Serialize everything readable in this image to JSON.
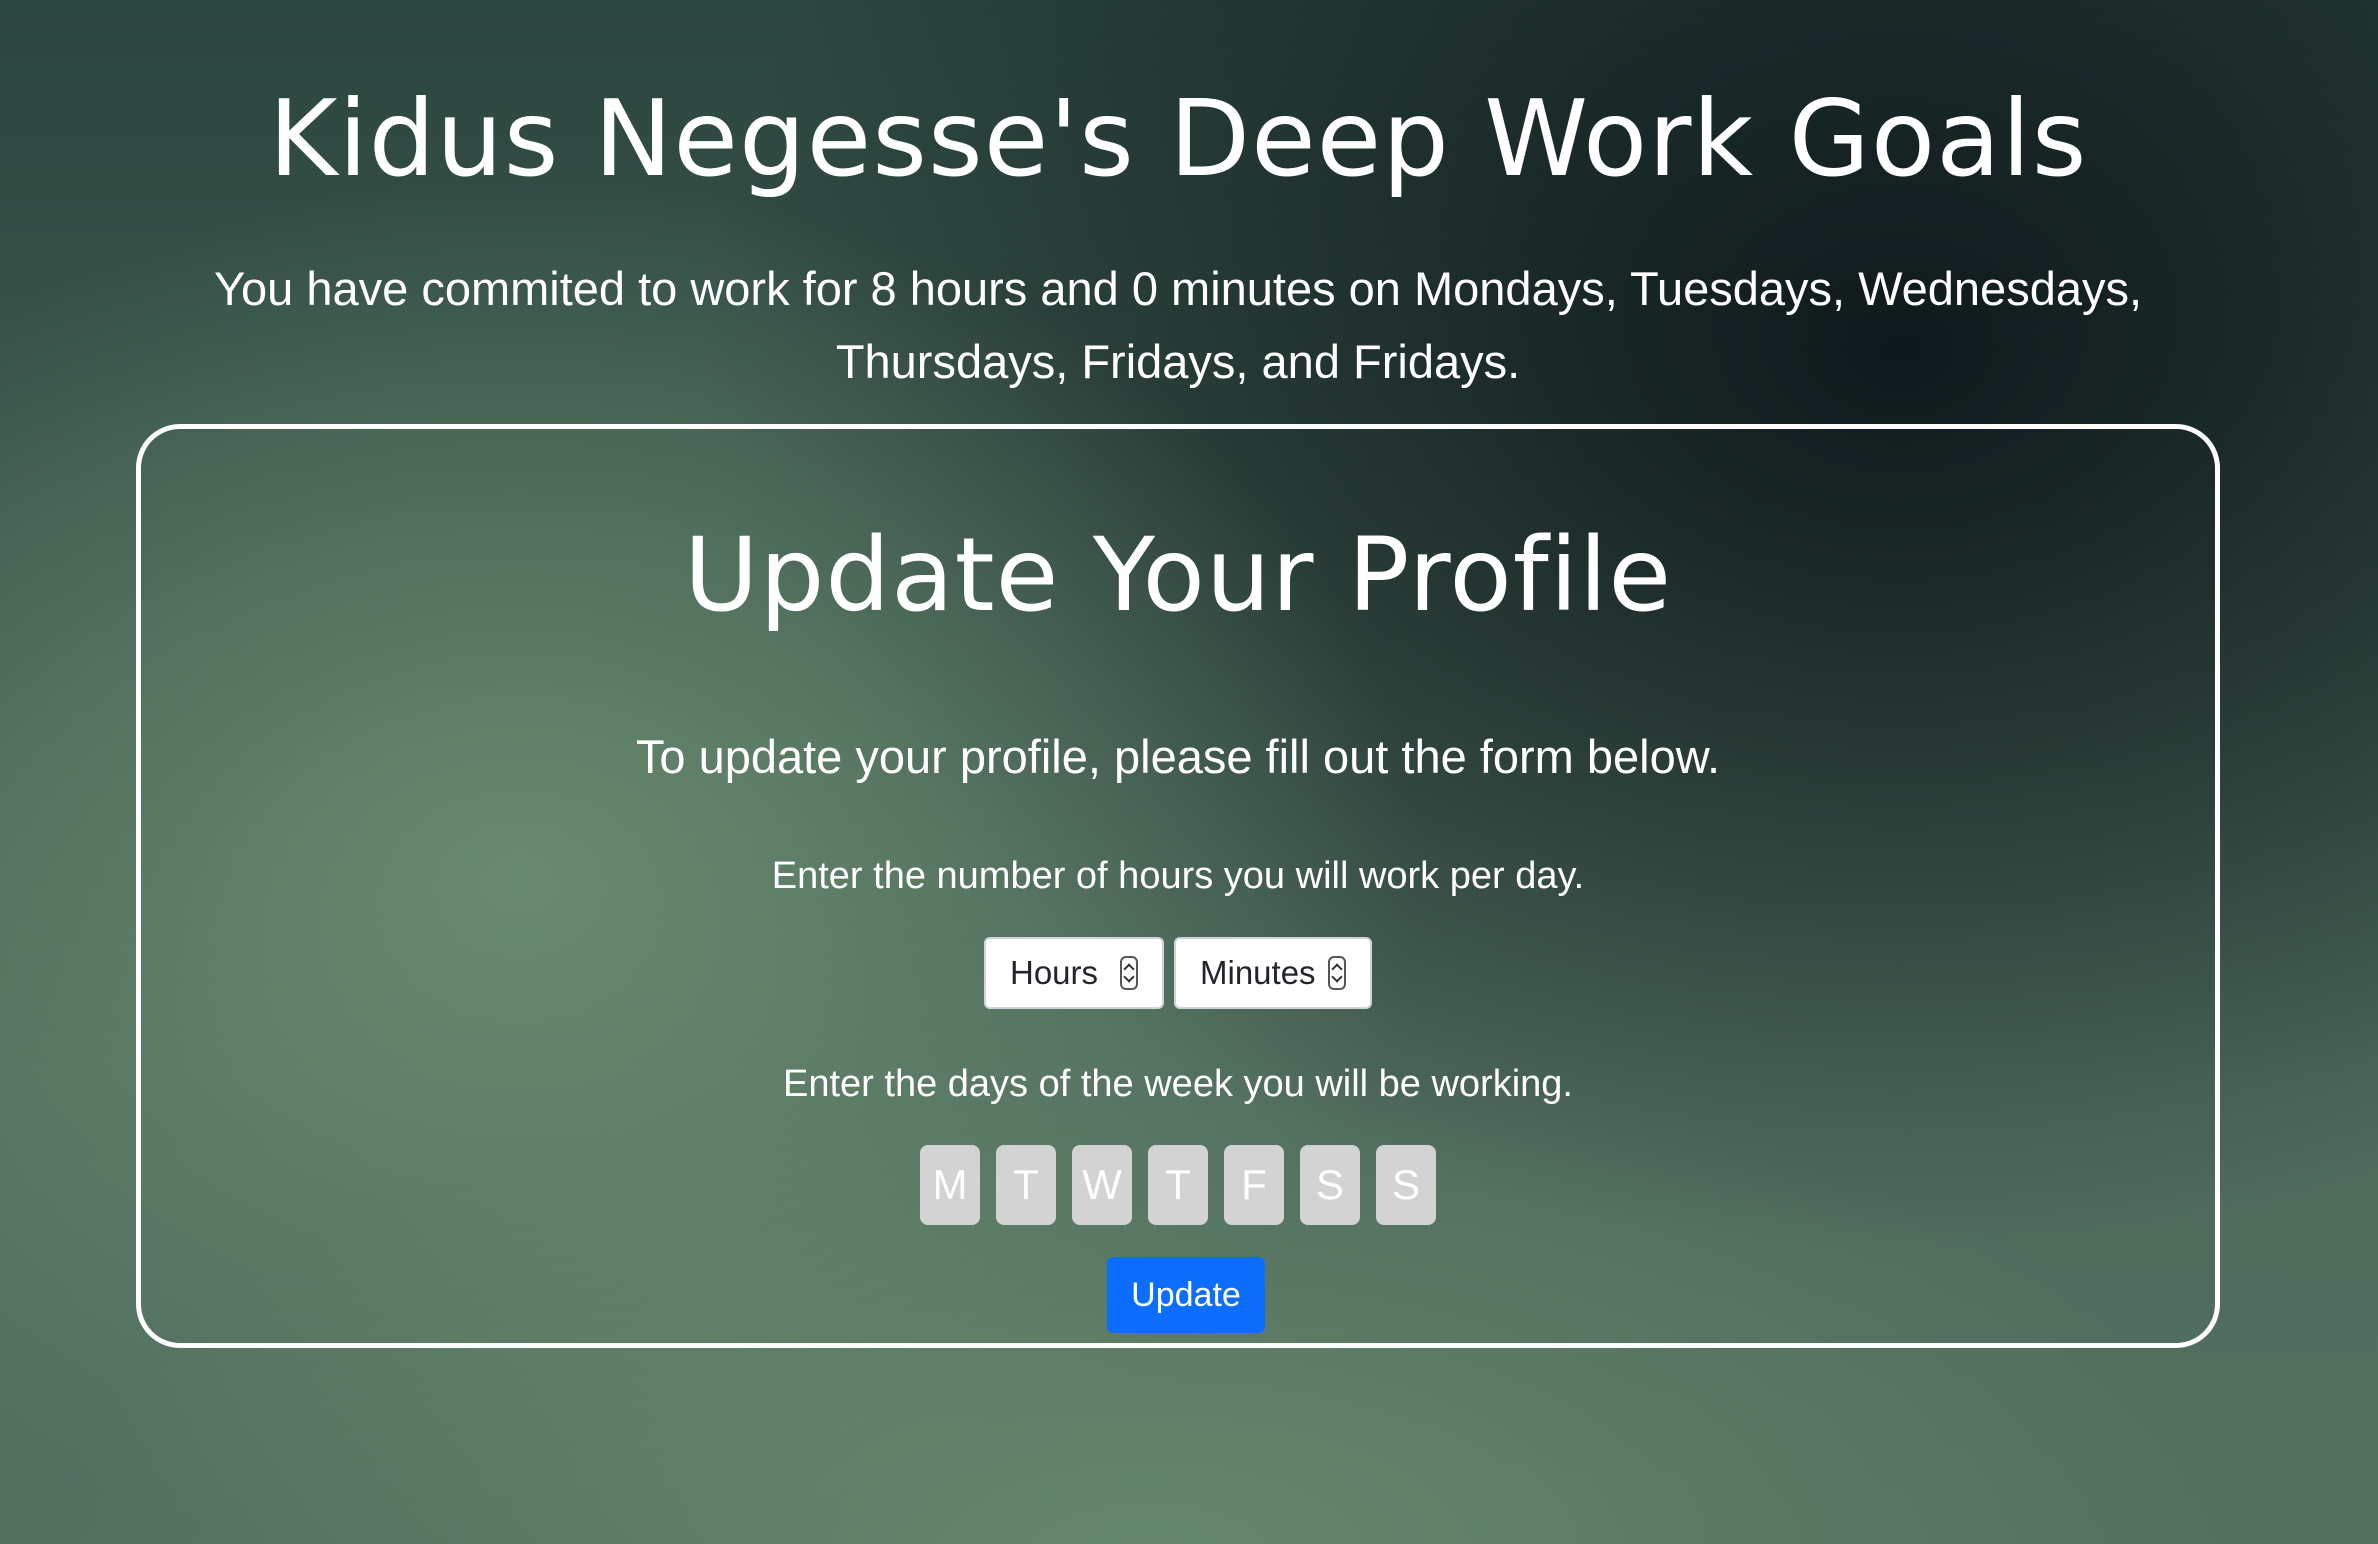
{
  "header": {
    "title": "Kidus Negesse's Deep Work Goals",
    "commitment_text": "You have commited to work for 8 hours and 0 minutes on Mondays, Tuesdays, Wednesdays, Thursdays, Fridays, and Fridays."
  },
  "profile_form": {
    "title": "Update Your Profile",
    "intro": "To update your profile, please fill out the form below.",
    "hours_label": "Enter the number of hours you will work per day.",
    "hours_select": {
      "value": "Hours"
    },
    "minutes_select": {
      "value": "Minutes"
    },
    "days_label": "Enter the days of the week you will be working.",
    "days": [
      "M",
      "T",
      "W",
      "T",
      "F",
      "S",
      "S"
    ],
    "submit_label": "Update",
    "colors": {
      "day_button_bg": "#d3d3d3",
      "submit_bg": "#0d6efd",
      "card_border": "#ffffff"
    }
  }
}
